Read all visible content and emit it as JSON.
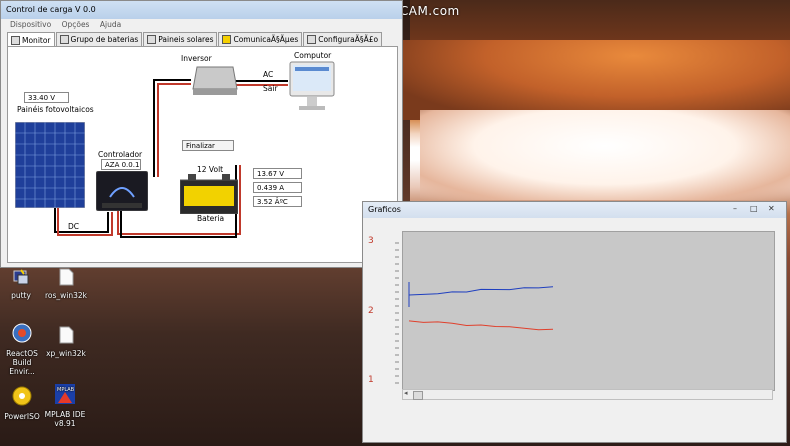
{
  "watermark": "www.BANDICAM.com",
  "main_window": {
    "title": "Control de carga V 0.0",
    "menu": [
      "Dispositivo",
      "Opções",
      "Ajuda"
    ],
    "tabs": [
      "Monitor",
      "Grupo de baterias",
      "Paineis solares",
      "ComunicaÃ§Ãµes",
      "ConfiguraÃ§Ã£o"
    ],
    "diagram": {
      "panel_voltage": "33.40 V",
      "panel_label": "Painéis fotovoltaicos",
      "controller_label": "Controlador",
      "controller_version": "AZA 0.0.1",
      "inverter_label": "Inversor",
      "computer_label": "Computor",
      "ac_label": "AC",
      "output_label": "Sair",
      "finalize_button": "Finalizar",
      "battery_type": "12 Volt",
      "battery_label": "Bateria",
      "battery_voltage": "13.67 V",
      "battery_current": "0.439 A",
      "battery_temp": "3.52 ÂºC",
      "dc_label": "DC"
    }
  },
  "graph_window": {
    "title": "Graficos",
    "controls": [
      "–",
      "□",
      "✕"
    ],
    "y_ticks": [
      "3",
      "2",
      "1"
    ]
  },
  "chart_data": {
    "type": "line",
    "ylim": [
      1,
      3
    ],
    "y_ticks": [
      3,
      2,
      1
    ],
    "grid": false,
    "series": [
      {
        "color": "#1f3fbf",
        "x": [
          0,
          10,
          20,
          30,
          40,
          50,
          60,
          70,
          80,
          90,
          100
        ],
        "values": [
          2.25,
          2.27,
          2.29,
          2.3,
          2.31,
          2.33,
          2.34,
          2.35,
          2.36,
          2.37,
          2.37
        ]
      },
      {
        "color": "#e0402c",
        "x": [
          0,
          10,
          20,
          30,
          40,
          50,
          60,
          70,
          80,
          90,
          100
        ],
        "values": [
          1.88,
          1.87,
          1.86,
          1.85,
          1.83,
          1.82,
          1.81,
          1.79,
          1.78,
          1.77,
          1.76
        ]
      }
    ]
  },
  "desktop_icons": [
    {
      "label": "putty",
      "icon": "putty-icon"
    },
    {
      "label": "ros_win32k",
      "icon": "file-icon"
    },
    {
      "label": "ReactOS Build Envir...",
      "icon": "reactos-icon"
    },
    {
      "label": "xp_win32k",
      "icon": "file-icon"
    },
    {
      "label": "PowerISO",
      "icon": "poweriso-icon"
    },
    {
      "label": "MPLAB IDE v8.91",
      "icon": "mplab-icon"
    }
  ],
  "mplab_logo_text": "MPLAB IDE"
}
